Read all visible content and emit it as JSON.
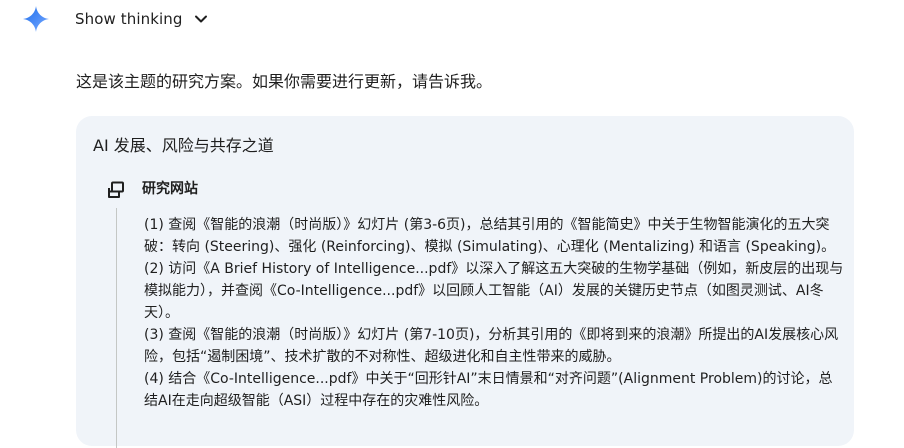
{
  "header": {
    "logo_icon": "gemini-sparkle-icon",
    "show_thinking_label": "Show thinking",
    "toggle_icon": "chevron-down-icon"
  },
  "message": {
    "intro": "这是该主题的研究方案。如果你需要进行更新，请告诉我。"
  },
  "plan": {
    "title": "AI 发展、风险与共存之道",
    "section_icon": "research-websites-icon",
    "section_title": "研究网站",
    "steps": [
      "(1) 查阅《智能的浪潮（时尚版）》幻灯片 (第3-6页)，总结其引用的《智能简史》中关于生物智能演化的五大突破：转向 (Steering)、强化 (Reinforcing)、模拟 (Simulating)、心理化 (Mentalizing) 和语言 (Speaking)。",
      "(2) 访问《A Brief History of Intelligence...pdf》以深入了解这五大突破的生物学基础（例如，新皮层的出现与模拟能力），并查阅《Co-Intelligence...pdf》以回顾人工智能（AI）发展的关键历史节点（如图灵测试、AI冬天）。",
      "(3) 查阅《智能的浪潮（时尚版）》幻灯片 (第7-10页)，分析其引用的《即将到来的浪潮》所提出的AI发展核心风险，包括“遏制困境”、技术扩散的不对称性、超级进化和自主性带来的威胁。",
      "(4) 结合《Co-Intelligence...pdf》中关于“回形针AI”末日情景和“对齐问题”(Alignment Problem)的讨论，总结AI在走向超级智能（ASI）过程中存在的灾难性风险。"
    ]
  },
  "colors": {
    "card_background": "#f0f4f9",
    "text": "#1f1f1f",
    "timeline": "#c4c7c5",
    "gem_blue": "#4f8ef7"
  }
}
